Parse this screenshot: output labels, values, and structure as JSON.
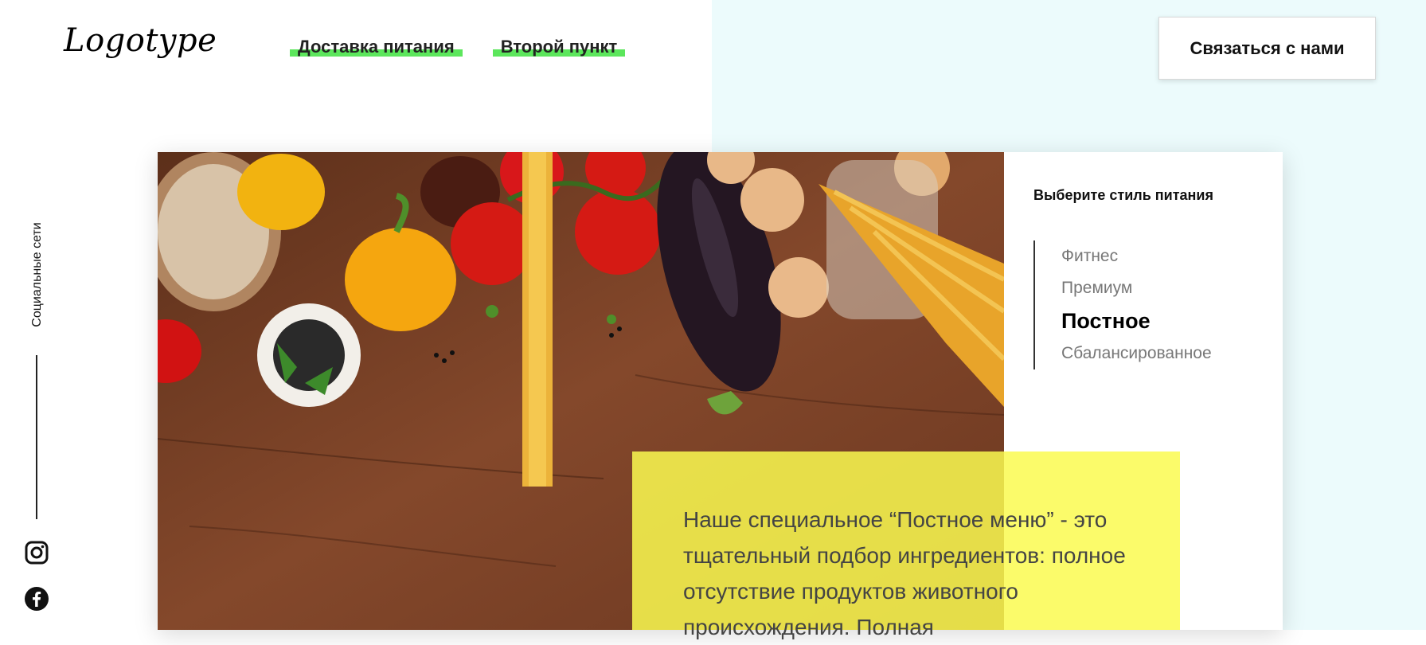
{
  "header": {
    "logo": "Logotype",
    "nav": [
      {
        "label": "Доставка питания"
      },
      {
        "label": "Второй пункт"
      }
    ],
    "contact_button": "Связаться с нами"
  },
  "sidebar": {
    "social_label": "Социальные сети",
    "icons": [
      "instagram-icon",
      "facebook-icon"
    ]
  },
  "panel": {
    "title": "Выберите стиль питания",
    "styles": [
      {
        "label": "Фитнес",
        "active": false
      },
      {
        "label": "Премиум",
        "active": false
      },
      {
        "label": "Постное",
        "active": true
      },
      {
        "label": "Сбалансированное",
        "active": false
      }
    ]
  },
  "description": "Наше специальное “Постное меню” - это тщательный подбор ингредиентов: полное отсутствие продуктов животного происхождения. Полная",
  "colors": {
    "accent_green": "#5ce65c",
    "highlight_yellow": "#fafa50",
    "right_background": "#ecfbfc"
  }
}
